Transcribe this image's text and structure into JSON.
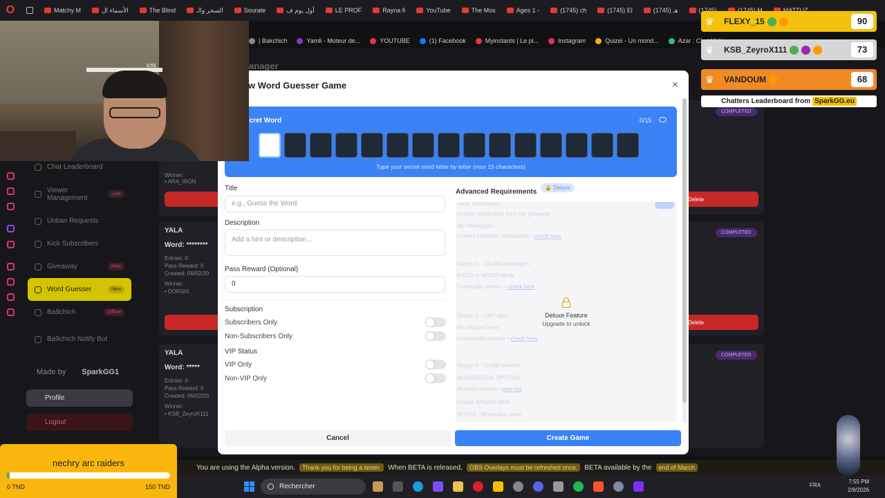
{
  "browser": {
    "tabs": [
      "Matchy M",
      "الأسماء ال",
      "The Blind",
      "السحر والـ",
      "Sourate",
      "أول يوم ف",
      "LE PROF",
      "Rayna fi",
      "YouTube",
      "The Mos",
      "Ages 1 -",
      "(1745) ch",
      "(1745) El",
      "(1745) هـ",
      "(1745)",
      "(1745) M",
      "MATTUZ"
    ],
    "bookmarks": [
      {
        "label": "| Bakchich",
        "color": "#888888"
      },
      {
        "label": "Yamli - Moteur de...",
        "color": "#7b3fc0"
      },
      {
        "label": "YOUTUBE",
        "color": "#e53935"
      },
      {
        "label": "(1) Facebook",
        "color": "#1877f2"
      },
      {
        "label": "Myinstants | Le pl...",
        "color": "#e53935"
      },
      {
        "label": "Instagram",
        "color": "#e1306c"
      },
      {
        "label": "Quizei - Un mond...",
        "color": "#f5b301"
      },
      {
        "label": "Azar : Chat Vidéo...",
        "color": "#2ebd85"
      }
    ]
  },
  "webcam": {
    "clock": "8:55"
  },
  "dashboard": {
    "page_title_fragment": "anager",
    "sidebar": [
      {
        "label": "Chat Leaderboard",
        "badge": ""
      },
      {
        "label": "Viewer Management",
        "badge": "Live"
      },
      {
        "label": "Unban Requests",
        "badge": ""
      },
      {
        "label": "Kick Subscribers",
        "badge": ""
      },
      {
        "label": "Giveaway",
        "badge": "New"
      },
      {
        "label": "Word Guesser",
        "badge": "New",
        "active": true
      },
      {
        "label": "Ba9chich",
        "badge": "Offline"
      },
      {
        "label": "Ba9chich Notify Bot",
        "badge": ""
      }
    ],
    "made_by_label": "Made by",
    "made_by_brand": "SparkGG1",
    "profile_label": "Profile",
    "logout_label": "Logout",
    "cards": [
      {
        "title": "",
        "lines": [
          "Winner:",
          "• ARA_IRON"
        ],
        "status": "COMPLETED",
        "delete": "Delete"
      },
      {
        "title": "YALA",
        "word": "Word: ********",
        "lines": [
          "Entries: 0",
          "Pass Reward: 0",
          "Created: 06/02/20",
          "Winner:",
          "• DORSIX"
        ],
        "status": "COMPLETED",
        "delete": "Delete"
      },
      {
        "title": "YALA",
        "word": "Word: *****",
        "lines": [
          "Entries: 0",
          "Pass Reward: 0",
          "Created: 06/02/20",
          "Winner:",
          "• KSB_ZeyroX111"
        ],
        "status": "COMPLETED",
        "delete": "Delete"
      }
    ]
  },
  "modal": {
    "title": "w Word Guesser Game",
    "close_label": "×",
    "secret": {
      "label": "ecret Word",
      "count": "0/15",
      "hint": "Type your secret word letter by letter (max 15 characters)",
      "boxes": 15
    },
    "title_label": "Title",
    "title_placeholder": "e.g., Guess the Word",
    "description_label": "Description",
    "description_placeholder": "Add a hint or description...",
    "pass_reward_label": "Pass Reward (Optional)",
    "pass_reward_value": "0",
    "subscription_label": "Subscription",
    "subscribers_only": "Subscribers Only",
    "non_subscribers_only": "Non-Subscribers Only",
    "vip_status_label": "VIP Status",
    "vip_only": "VIP Only",
    "non_vip_only": "Non-VIP Only",
    "advanced_label": "Advanced Requirements",
    "deluxe_badge": "Deluxe",
    "locked_rows": [
      {
        "text": "Allow Moderators",
        "link": ""
      },
      {
        "text": "Include moderators from the giveaway",
        "link": ""
      },
      {
        "text": "Min Messages",
        "link": ""
      },
      {
        "text": "Current Chatters' contribution • ",
        "link": "check here"
      },
      {
        "text": "Range 0 - 100,000 messages",
        "link": ""
      },
      {
        "text": "RATIO or MIXED Mode",
        "link": ""
      },
      {
        "text": "Eventually viewers • ",
        "link": "check here"
      },
      {
        "text": "Range 0 - 1000 days",
        "link": ""
      },
      {
        "text": "Min Watch Count",
        "link": ""
      },
      {
        "text": "Community viewers • ",
        "link": "check here"
      },
      {
        "text": "Range 0 - 10,000 viewers",
        "link": ""
      },
      {
        "text": "MODERATION OPTIONS",
        "link": ""
      },
      {
        "text": "Blocked viewers • ",
        "link": "view list"
      },
      {
        "text": "Enable Whitelist Mod",
        "link": ""
      },
      {
        "text": "NOTES - Moderator notes",
        "link": ""
      }
    ],
    "deluxe_feature_title": "Deluxe Feature",
    "deluxe_feature_sub": "Upgrade to unlock",
    "cancel_label": "Cancel",
    "create_label": "Create Game"
  },
  "leaderboard": {
    "rows": [
      {
        "name": "FLEXY_15",
        "score": "90",
        "bg": "#f4c20d"
      },
      {
        "name": "KSB_ZeyroX111",
        "score": "73",
        "bg": "#d6d6d6"
      },
      {
        "name": "VANDOUM",
        "score": "68",
        "bg": "#f08a24"
      }
    ],
    "caption": "Chatters Leaderboard from",
    "brand": "SparkGG.eu"
  },
  "goal": {
    "title": "nechry arc raiders",
    "current": "0 TND",
    "target": "150 TND",
    "progress_fraction": 0
  },
  "alpha_banner": {
    "t1": "You are using the Alpha version.",
    "p1": "Thank you for being a tester.",
    "t2": "When BETA is released,",
    "p2": "OBS Overlays must be refreshed once.",
    "t3": "BETA available by the",
    "p3": "end of March"
  },
  "taskbar": {
    "search_label": "Rechercher",
    "lang": "FRA",
    "time": "7:55 PM",
    "date": "2/9/2026"
  }
}
